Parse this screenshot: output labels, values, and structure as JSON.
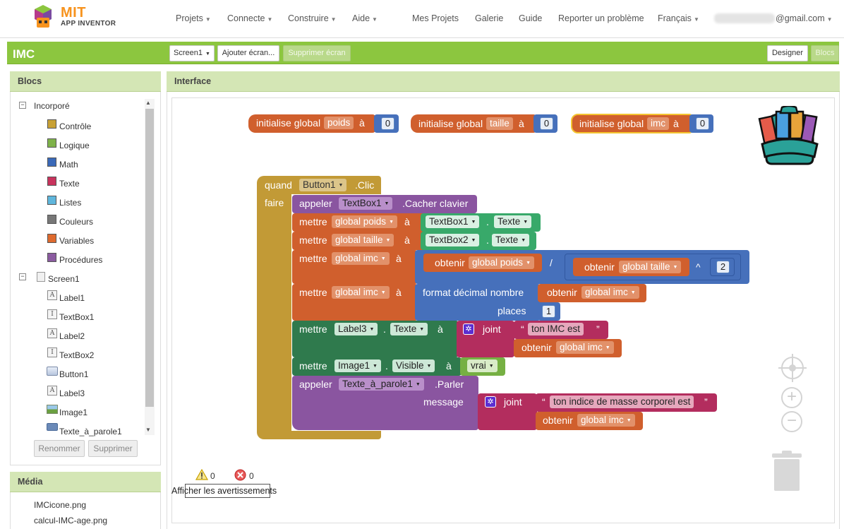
{
  "header": {
    "logo_mit": "MIT",
    "logo_sub": "APP INVENTOR",
    "menus": [
      "Projets",
      "Connecte",
      "Construire",
      "Aide"
    ],
    "links": [
      "Mes Projets",
      "Galerie",
      "Guide",
      "Reporter un problème"
    ],
    "language": "Français",
    "account": "@gmail.com"
  },
  "project": {
    "title": "IMC",
    "screen_select": "Screen1",
    "add_screen": "Ajouter écran...",
    "remove_screen": "Supprimer écran",
    "designer": "Designer",
    "blocks": "Blocs"
  },
  "blocks_panel": {
    "title": "Blocs",
    "builtin": "Incorporé",
    "builtin_items": [
      {
        "label": "Contrôle",
        "color": "#c8a135"
      },
      {
        "label": "Logique",
        "color": "#7fb24a"
      },
      {
        "label": "Math",
        "color": "#3a69b8"
      },
      {
        "label": "Texte",
        "color": "#c8335d"
      },
      {
        "label": "Listes",
        "color": "#5fb6dc"
      },
      {
        "label": "Couleurs",
        "color": "#777777"
      },
      {
        "label": "Variables",
        "color": "#de6a2e"
      },
      {
        "label": "Procédures",
        "color": "#8b5ba0"
      }
    ],
    "screen": "Screen1",
    "components": [
      "Label1",
      "TextBox1",
      "Label2",
      "TextBox2",
      "Button1",
      "Label3",
      "Image1",
      "Texte_à_parole1"
    ],
    "rename": "Renommer",
    "delete": "Supprimer"
  },
  "media_panel": {
    "title": "Média",
    "files": [
      "IMCicone.png",
      "calcul-IMC-age.png"
    ]
  },
  "workspace": {
    "title": "Interface",
    "globals": [
      {
        "init": "initialise global",
        "name": "poids",
        "to": "à",
        "value": "0"
      },
      {
        "init": "initialise global",
        "name": "taille",
        "to": "à",
        "value": "0"
      },
      {
        "init": "initialise global",
        "name": "imc",
        "to": "à",
        "value": "0"
      }
    ],
    "event": {
      "when": "quand",
      "component": "Button1",
      "event": ".Clic",
      "do": "faire"
    },
    "call1": {
      "call": "appeler",
      "component": "TextBox1",
      "method": ".Cacher clavier"
    },
    "set_poids": {
      "set": "mettre",
      "var": "global poids",
      "to": "à",
      "comp": "TextBox1",
      "prop": "Texte"
    },
    "set_taille": {
      "set": "mettre",
      "var": "global taille",
      "to": "à",
      "comp": "TextBox2",
      "prop": "Texte"
    },
    "set_imc": {
      "set": "mettre",
      "var": "global imc",
      "to": "à",
      "get": "obtenir",
      "var_poids": "global poids",
      "div": "/",
      "var_taille": "global taille",
      "pow": "^",
      "exp": "2"
    },
    "set_imc2": {
      "set": "mettre",
      "var": "global imc",
      "to": "à",
      "format": "format décimal nombre",
      "get": "obtenir",
      "var_imc": "global imc",
      "places": "places",
      "places_val": "1"
    },
    "set_label3": {
      "set": "mettre",
      "comp": "Label3",
      "prop": "Texte",
      "to": "à",
      "join": "joint",
      "str": "ton IMC est",
      "get": "obtenir",
      "var_imc": "global imc"
    },
    "set_image1": {
      "set": "mettre",
      "comp": "Image1",
      "prop": "Visible",
      "to": "à",
      "bool": "vrai"
    },
    "call_tts": {
      "call": "appeler",
      "component": "Texte_à_parole1",
      "method": ".Parler",
      "message": "message",
      "join": "joint",
      "str": "ton indice de masse corporel est",
      "get": "obtenir",
      "var_imc": "global imc"
    },
    "warnings_count": "0",
    "errors_count": "0",
    "show_warnings": "Afficher les avertissements",
    "quote_open": "“",
    "quote_close": "”"
  },
  "colors": {
    "green": "#8cc63f",
    "var": "#d05f2d",
    "ctrl": "#c29a36",
    "proc": "#8a55a0",
    "comp": "#2f7a4d",
    "comp_get": "#38a96a",
    "text": "#b32d5e",
    "math": "#4670bb",
    "logic": "#76b043"
  }
}
